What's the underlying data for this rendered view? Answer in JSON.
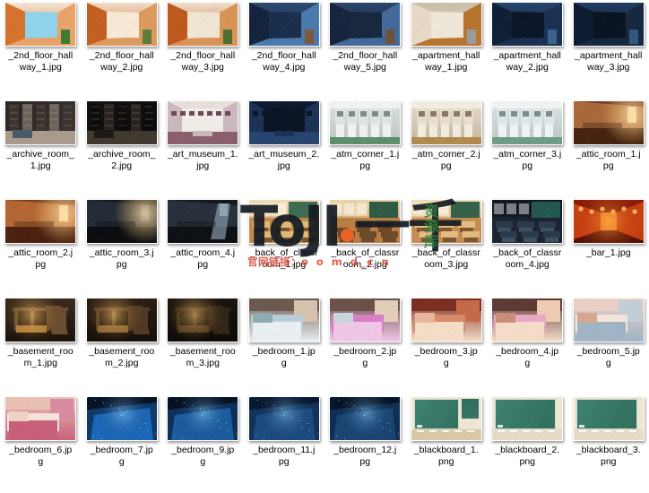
{
  "view": {
    "type": "file-thumbnail-grid",
    "columns": 8,
    "rows": 5,
    "background_color": "#ffffff",
    "caption_color": "#000000",
    "item_count": 40
  },
  "items": [
    {
      "name": "_2nd_floor_hallway_1.jpg",
      "line1": "_2nd_floor_hall",
      "line2": "way_1.jpg",
      "extension": "jpg",
      "thumb": {
        "palette": [
          "#d5722c",
          "#f3e4d4",
          "#e9a268",
          "#8fd4ea",
          "#3f7a33"
        ],
        "style": "hallway-warm"
      }
    },
    {
      "name": "_2nd_floor_hallway_2.jpg",
      "line1": "_2nd_floor_hall",
      "line2": "way_2.jpg",
      "extension": "jpg",
      "thumb": {
        "palette": [
          "#c45f22",
          "#f2dcc6",
          "#dd9a5e",
          "#f6ead8",
          "#5e7d3a"
        ],
        "style": "hallway-warm2"
      }
    },
    {
      "name": "_2nd_floor_hallway_3.jpg",
      "line1": "_2nd_floor_hall",
      "line2": "way_3.jpg",
      "extension": "jpg",
      "thumb": {
        "palette": [
          "#bf5a1f",
          "#efe0cd",
          "#d89356",
          "#f0e5d3",
          "#4e6f30"
        ],
        "style": "hallway-warm3"
      }
    },
    {
      "name": "_2nd_floor_hallway_4.jpg",
      "line1": "_2nd_floor_hall",
      "line2": "way_4.jpg",
      "extension": "jpg",
      "thumb": {
        "palette": [
          "#15233c",
          "#2d4a73",
          "#4c79ad",
          "#1b2f4d",
          "#7a5a3c"
        ],
        "style": "hallway-night"
      }
    },
    {
      "name": "_2nd_floor_hallway_5.jpg",
      "line1": "_2nd_floor_hall",
      "line2": "way_5.jpg",
      "extension": "jpg",
      "thumb": {
        "palette": [
          "#16243d",
          "#2b456b",
          "#43689a",
          "#18293f",
          "#6f5238"
        ],
        "style": "hallway-night2"
      }
    },
    {
      "name": "_apartment_hallway_1.jpg",
      "line1": "_apartment_hall",
      "line2": "way_1.jpg",
      "extension": "jpg",
      "thumb": {
        "palette": [
          "#e8d9c6",
          "#c9bda8",
          "#b8752f",
          "#efe6d8",
          "#9a9a9a"
        ],
        "style": "apartment-day"
      }
    },
    {
      "name": "_apartment_hallway_2.jpg",
      "line1": "_apartment_hall",
      "line2": "way_2.jpg",
      "extension": "jpg",
      "thumb": {
        "palette": [
          "#101f36",
          "#24456e",
          "#1a3152",
          "#0c1727",
          "#3a628f"
        ],
        "style": "apartment-night"
      }
    },
    {
      "name": "_apartment_hallway_3.jpg",
      "line1": "_apartment_hall",
      "line2": "way_3.jpg",
      "extension": "jpg",
      "thumb": {
        "palette": [
          "#0e1c31",
          "#1f3c61",
          "#16283f",
          "#0a1422",
          "#33567f"
        ],
        "style": "apartment-night2"
      }
    },
    {
      "name": "_archive_room_1.jpg",
      "line1": "_archive_room_",
      "line2": "1.jpg",
      "extension": "jpg",
      "thumb": {
        "palette": [
          "#2b2422",
          "#6d625a",
          "#a99a8c",
          "#3b332e",
          "#4a5a6b"
        ],
        "style": "archive-lit"
      }
    },
    {
      "name": "_archive_room_2.jpg",
      "line1": "_archive_room_",
      "line2": "2.jpg",
      "extension": "jpg",
      "thumb": {
        "palette": [
          "#15110f",
          "#2a231f",
          "#413830",
          "#0d0b0a",
          "#1d1917"
        ],
        "style": "archive-dark"
      }
    },
    {
      "name": "_art_museum_1.jpg",
      "line1": "_art_museum_1.",
      "line2": "jpg",
      "extension": "jpg",
      "thumb": {
        "palette": [
          "#e7ddd9",
          "#cbb8bd",
          "#8a5f6d",
          "#f1ebe8",
          "#6b4a56"
        ],
        "style": "museum-light"
      }
    },
    {
      "name": "_art_museum_2.jpg",
      "line1": "_art_museum_2.",
      "line2": "jpg",
      "extension": "jpg",
      "thumb": {
        "palette": [
          "#0d1a30",
          "#1b3256",
          "#27456f",
          "#0a1425",
          "#35year"
        ],
        "style": "museum-night"
      }
    },
    {
      "name": "_atm_corner_1.jpg",
      "line1": "_atm_corner_1.j",
      "line2": "pg",
      "extension": "jpg",
      "thumb": {
        "palette": [
          "#dfe3e2",
          "#b9c2c0",
          "#7f8d8a",
          "#f0f2f1",
          "#5d8f6a"
        ],
        "style": "atm-day"
      }
    },
    {
      "name": "_atm_corner_2.jpg",
      "line1": "_atm_corner_2.j",
      "line2": "pg",
      "extension": "jpg",
      "thumb": {
        "palette": [
          "#e6ddcf",
          "#c2b49d",
          "#8a7a63",
          "#f2ece0",
          "#b08a4e"
        ],
        "style": "atm-warm"
      }
    },
    {
      "name": "_atm_corner_3.jpg",
      "line1": "_atm_corner_3.j",
      "line2": "pg",
      "extension": "jpg",
      "thumb": {
        "palette": [
          "#dfe6e6",
          "#b6c3c4",
          "#7d8c8e",
          "#eef3f3",
          "#6f9c84"
        ],
        "style": "atm-cool"
      }
    },
    {
      "name": "_attic_room_1.jpg",
      "line1": "_attic_room_1.j",
      "line2": "pg",
      "extension": "jpg",
      "thumb": {
        "palette": [
          "#6d3b22",
          "#a8683a",
          "#d9a871",
          "#47240f",
          "#efd9ae"
        ],
        "style": "attic-warm"
      }
    },
    {
      "name": "_attic_room_2.jpg",
      "line1": "_attic_room_2.j",
      "line2": "pg",
      "extension": "jpg",
      "thumb": {
        "palette": [
          "#7d3f1d",
          "#b26733",
          "#e2a665",
          "#4b2210",
          "#f0d9a8"
        ],
        "style": "attic-warm2"
      }
    },
    {
      "name": "_attic_room_3.jpg",
      "line1": "_attic_room_3.j",
      "line2": "pg",
      "extension": "jpg",
      "thumb": {
        "palette": [
          "#13161c",
          "#242b36",
          "#343e4c",
          "#0b0d11",
          "#46525f"
        ],
        "style": "attic-dark"
      }
    },
    {
      "name": "_attic_room_4.jpg",
      "line1": "_attic_room_4.j",
      "line2": "pg",
      "extension": "jpg",
      "thumb": {
        "palette": [
          "#141920",
          "#27303b",
          "#3b4854",
          "#0d1015",
          "#8fa3b2"
        ],
        "style": "attic-moonlit"
      }
    },
    {
      "name": "_back_of_classroom_1.jpg",
      "line1": "_back_of_classr",
      "line2": "oom_1.jpg",
      "extension": "jpg",
      "thumb": {
        "palette": [
          "#c18a4e",
          "#e0b878",
          "#3f6b52",
          "#f0dcb8",
          "#7a5430"
        ],
        "style": "classroom-1"
      }
    },
    {
      "name": "_back_of_classroom_2.jpg",
      "line1": "_back_of_classr",
      "line2": "oom_2.jpg",
      "extension": "jpg",
      "thumb": {
        "palette": [
          "#b87e44",
          "#d9ac६d",
          "#2f5a44",
          "#e9d3ab",
          "#6e4a29"
        ],
        "style": "classroom-2"
      }
    },
    {
      "name": "_back_of_classroom_3.jpg",
      "line1": "_back_of_classr",
      "line2": "oom_3.jpg",
      "extension": "jpg",
      "thumb": {
        "palette": [
          "#c48d52",
          "#e3bc7f",
          "#35614a",
          "#f1ddb9",
          "#7d5733"
        ],
        "style": "classroom-3"
      }
    },
    {
      "name": "_back_of_classroom_4.jpg",
      "line1": "_back_of_classr",
      "line2": "oom_4.jpg",
      "extension": "jpg",
      "thumb": {
        "palette": [
          "#1b2430",
          "#2c3b4c",
          "#24584f",
          "#111821",
          "#3d5163"
        ],
        "style": "classroom-night"
      }
    },
    {
      "name": "_bar_1.jpg",
      "line1": "_bar_1.jpg",
      "line2": "",
      "extension": "jpg",
      "thumb": {
        "palette": [
          "#8a1d0a",
          "#c63f12",
          "#f08a32",
          "#4d0f04",
          "#f6c06a"
        ],
        "style": "bar-red"
      }
    },
    {
      "name": "_basement_room_1.jpg",
      "line1": "_basement_roo",
      "line2": "m_1.jpg",
      "extension": "jpg",
      "thumb": {
        "palette": [
          "#3a2a1c",
          "#6b4d31",
          "#b8863f",
          "#1c130c",
          "#d7ab62"
        ],
        "style": "basement-lit"
      }
    },
    {
      "name": "_basement_room_2.jpg",
      "line1": "_basement_roo",
      "line2": "m_2.jpg",
      "extension": "jpg",
      "thumb": {
        "palette": [
          "#2a1f16",
          "#513a25",
          "#8f6a34",
          "#150f0a",
          "#b88c4c"
        ],
        "style": "basement-dim"
      }
    },
    {
      "name": "_basement_room_3.jpg",
      "line1": "_basement_roo",
      "line2": "m_3.jpg",
      "extension": "jpg",
      "thumb": {
        "palette": [
          "#1a1510",
          "#312619",
          "#4b3a23",
          "#0c0907",
          "#6b5430"
        ],
        "style": "basement-dark"
      }
    },
    {
      "name": "_bedroom_1.jpg",
      "line1": "_bedroom_1.jp",
      "line2": "g",
      "extension": "jpg",
      "thumb": {
        "palette": [
          "#6d5a4e",
          "#b9cdd6",
          "#e8eef1",
          "#8fa9b5",
          "#d7c2ae"
        ],
        "style": "bedroom-blue"
      }
    },
    {
      "name": "_bedroom_2.jpg",
      "line1": "_bedroom_2.jp",
      "line2": "g",
      "extension": "jpg",
      "thumb": {
        "palette": [
          "#6b5248",
          "#d97ec4",
          "#f0c6e6",
          "#c9d7dd",
          "#e2cdb8"
        ],
        "style": "bedroom-pink"
      }
    },
    {
      "name": "_bedroom_3.jpg",
      "line1": "_bedroom_3.jp",
      "line2": "g",
      "extension": "jpg",
      "thumb": {
        "palette": [
          "#7a2f22",
          "#d98a6a",
          "#f3ddc6",
          "#e9b49a",
          "#c56a48"
        ],
        "style": "bedroom-red"
      }
    },
    {
      "name": "_bedroom_4.jpg",
      "line1": "_bedroom_4.jp",
      "line2": "g",
      "extension": "jpg",
      "thumb": {
        "palette": [
          "#5e3a34",
          "#e8a7c4",
          "#f4dcc8",
          "#c98d7a",
          "#efcbb4"
        ],
        "style": "bedroom-rose"
      }
    },
    {
      "name": "_bedroom_5.jpg",
      "line1": "_bedroom_5.jp",
      "line2": "g",
      "extension": "jpg",
      "thumb": {
        "palette": [
          "#e9cfc4",
          "#f4e6dc",
          "#9fb4c4",
          "#d8a68f",
          "#c2cdd6"
        ],
        "style": "bedroom-light"
      }
    },
    {
      "name": "_bedroom_6.jpg",
      "line1": "_bedroom_6.jp",
      "line2": "g",
      "extension": "jpg",
      "thumb": {
        "palette": [
          "#e8c0b4",
          "#f6e2d8",
          "#c9607a",
          "#f0d2c4",
          "#d98ba0"
        ],
        "style": "bedroom-warm"
      }
    },
    {
      "name": "_bedroom_7.jpg",
      "line1": "_bedroom_7.jp",
      "line2": "g",
      "extension": "jpg",
      "thumb": {
        "palette": [
          "#071426",
          "#0f3a6b",
          "#1b67b5",
          "#041020",
          "#2f8fd6"
        ],
        "style": "bedroom-night"
      }
    },
    {
      "name": "_bedroom_9.jpg",
      "line1": "_bedroom_9.jp",
      "line2": "g",
      "extension": "jpg",
      "thumb": {
        "palette": [
          "#061222",
          "#0d2f58",
          "#1a5c9e",
          "#030b16",
          "#6fc2ef"
        ],
        "style": "bedroom-night2"
      }
    },
    {
      "name": "_bedroom_11.jpg",
      "line1": "_bedroom_11.j",
      "line2": "pg",
      "extension": "jpg",
      "thumb": {
        "palette": [
          "#08192e",
          "#12325a",
          "#1d4a7e",
          "#050f1c",
          "#2a5f93"
        ],
        "style": "bedroom-night3"
      }
    },
    {
      "name": "_bedroom_12.jpg",
      "line1": "_bedroom_12.j",
      "line2": "pg",
      "extension": "jpg",
      "thumb": {
        "palette": [
          "#071628",
          "#102d52",
          "#1a4472",
          "#040d18",
          "#255684"
        ],
        "style": "bedroom-night4"
      }
    },
    {
      "name": "_blackboard_1.png",
      "line1": "_blackboard_1.",
      "line2": "png",
      "extension": "png",
      "thumb": {
        "palette": [
          "#3e8370",
          "#2f6a59",
          "#efe6d2",
          "#d9c9a8",
          "#ffffff"
        ],
        "style": "blackboard-1"
      }
    },
    {
      "name": "_blackboard_2.png",
      "line1": "_blackboard_2.",
      "line2": "png",
      "extension": "png",
      "thumb": {
        "palette": [
          "#3e8370",
          "#2f6a59",
          "#efe6d2",
          "#e6dcc6",
          "#ffffff"
        ],
        "style": "blackboard-2"
      }
    },
    {
      "name": "_blackboard_3.png",
      "line1": "_blackboard_3.",
      "line2": "png",
      "extension": "png",
      "thumb": {
        "palette": [
          "#3e8370",
          "#2f6a59",
          "#efe6d2",
          "#e6dcc6",
          "#ffffff"
        ],
        "style": "blackboard-3"
      }
    }
  ],
  "watermark": {
    "logo_text_left": "ToJI",
    "logo_text_right": "一千",
    "vertical_text": "资源库",
    "url_prefix": "官网链接：",
    "url_text": "o o m d_c n",
    "dot_color": "#e8622a",
    "logo_color": "#141a22",
    "vertical_color": "#2e8440",
    "url_color": "#e0564a"
  }
}
